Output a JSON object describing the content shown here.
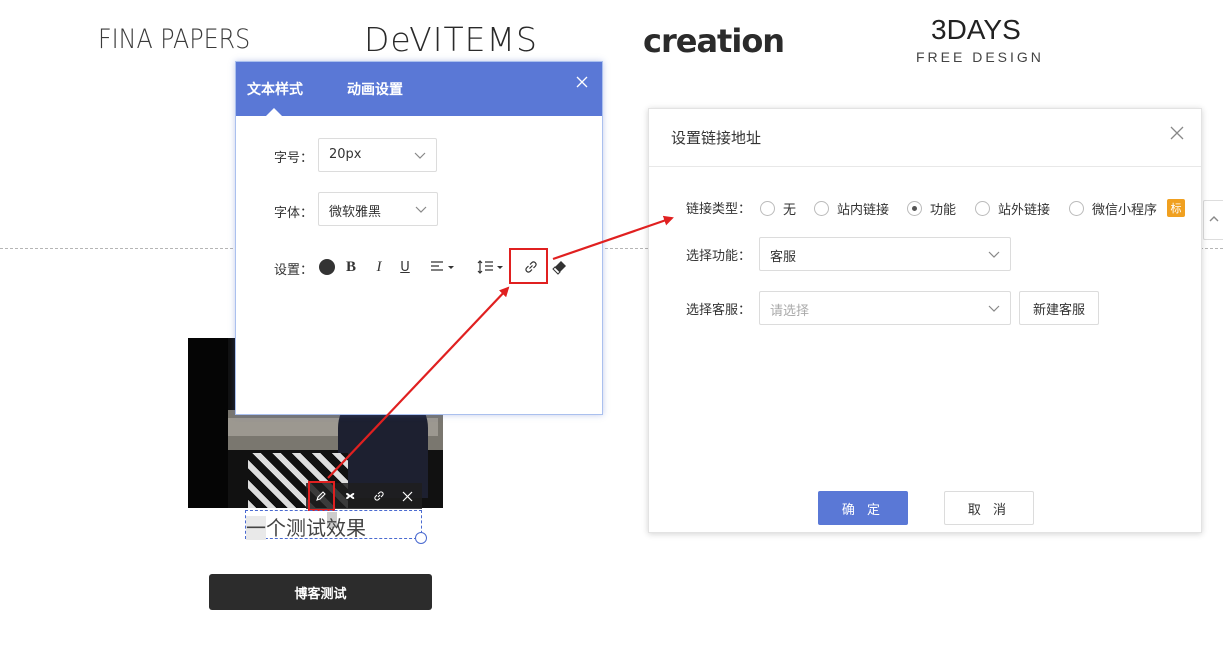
{
  "logos": {
    "logo1": "FINA PAPERS",
    "logo2": "DeVITEMS",
    "logo3": "creation",
    "logo4_main": "3DAYS",
    "logo4_sub": "FREE DESIGN"
  },
  "canvas": {
    "selected_text_first": "一",
    "selected_text_rest": "个测试效果",
    "blog_button": "博客测试",
    "image_toolbar": [
      "edit-icon",
      "animation-icon",
      "link-icon",
      "close-icon"
    ]
  },
  "text_style_panel": {
    "tabs": [
      "文本样式",
      "动画设置"
    ],
    "active_tab": "文本样式",
    "font_size_label": "字号：",
    "font_size_value": "20px",
    "font_family_label": "字体：",
    "font_family_value": "微软雅黑",
    "settings_label": "设置：",
    "format_buttons": {
      "bold": "B",
      "italic": "I",
      "underline": "U"
    },
    "icons": [
      "color-dot-icon",
      "align-icon",
      "line-height-icon",
      "link-icon",
      "eraser-icon"
    ]
  },
  "link_dialog": {
    "title": "设置链接地址",
    "link_type_label": "链接类型：",
    "link_types": [
      "无",
      "站内链接",
      "功能",
      "站外链接",
      "微信小程序"
    ],
    "selected_link_type": "功能",
    "badge": "标",
    "function_label": "选择功能：",
    "function_value": "客服",
    "service_label": "选择客服：",
    "service_placeholder": "请选择",
    "new_service_button": "新建客服",
    "confirm_button": "确 定",
    "cancel_button": "取 消"
  },
  "colors": {
    "accent": "#5a78d6",
    "annotation": "#e02020",
    "dark_button": "#2c2c2c"
  }
}
